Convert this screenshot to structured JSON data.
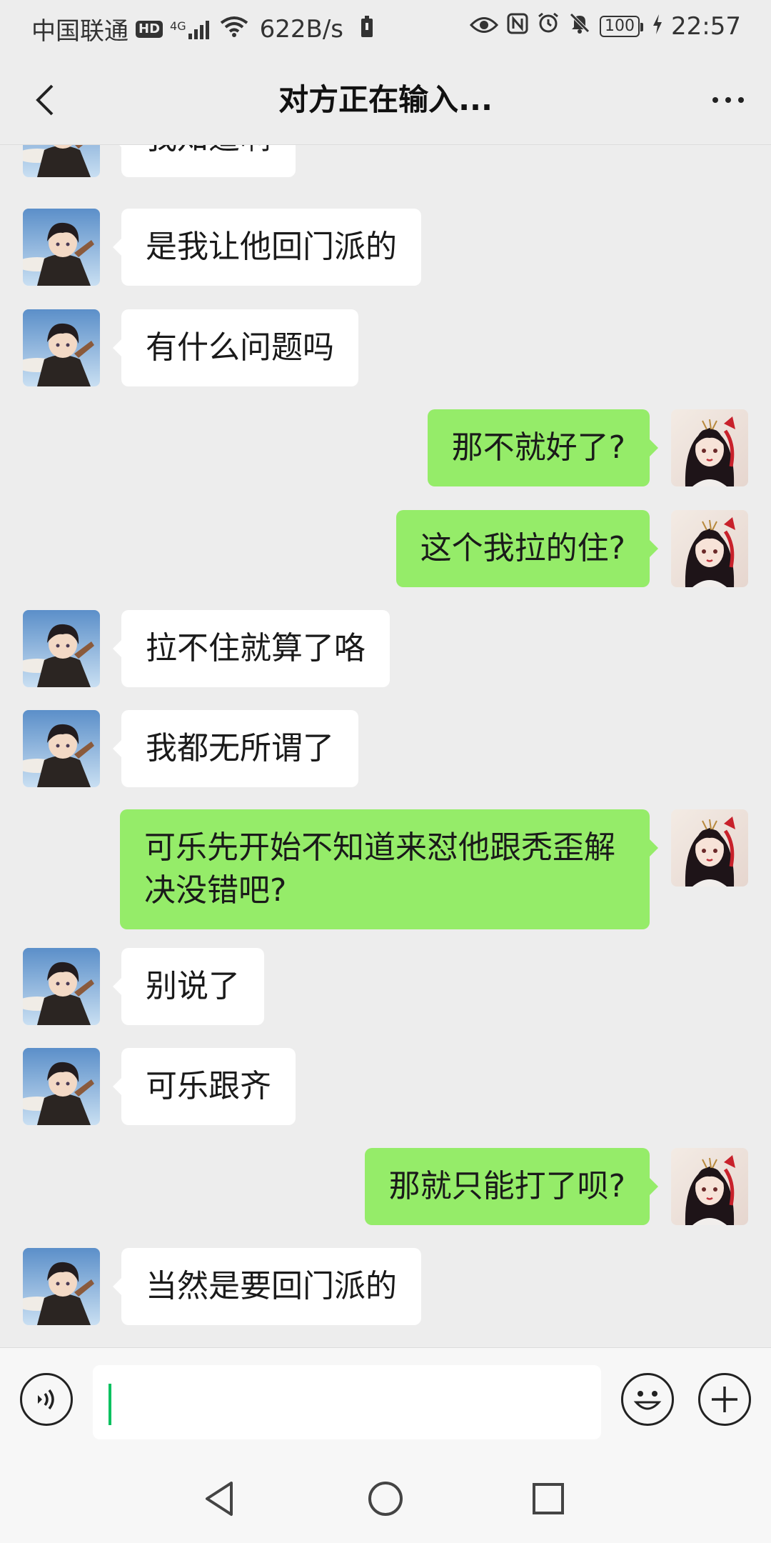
{
  "status_bar": {
    "carrier": "中国联通",
    "hd": "HD",
    "network": "4G",
    "speed": "622B/s",
    "battery": "100",
    "time": "22:57"
  },
  "header": {
    "title": "对方正在输入..."
  },
  "messages": [
    {
      "side": "left",
      "text": "我知道啊"
    },
    {
      "side": "left",
      "text": "是我让他回门派的"
    },
    {
      "side": "left",
      "text": "有什么问题吗"
    },
    {
      "side": "right",
      "text": "那不就好了?"
    },
    {
      "side": "right",
      "text": "这个我拉的住?"
    },
    {
      "side": "left",
      "text": "拉不住就算了咯"
    },
    {
      "side": "left",
      "text": "我都无所谓了"
    },
    {
      "side": "right",
      "text": "可乐先开始不知道来怼他跟秃歪解\n决没错吧?"
    },
    {
      "side": "left",
      "text": "别说了"
    },
    {
      "side": "left",
      "text": "可乐跟齐"
    },
    {
      "side": "right",
      "text": "那就只能打了呗?"
    },
    {
      "side": "left",
      "text": "当然是要回门派的"
    }
  ],
  "input": {
    "value": ""
  },
  "colors": {
    "background": "#ededed",
    "self_bubble": "#95ec69",
    "other_bubble": "#ffffff",
    "caret": "#07c160"
  },
  "icons": {
    "back": "chevron-left-icon",
    "more": "more-dots-icon",
    "voice": "voice-icon",
    "emoji": "emoji-icon",
    "plus": "plus-icon",
    "nav_back": "nav-back-icon",
    "nav_home": "nav-home-icon",
    "nav_recent": "nav-recent-icon"
  }
}
